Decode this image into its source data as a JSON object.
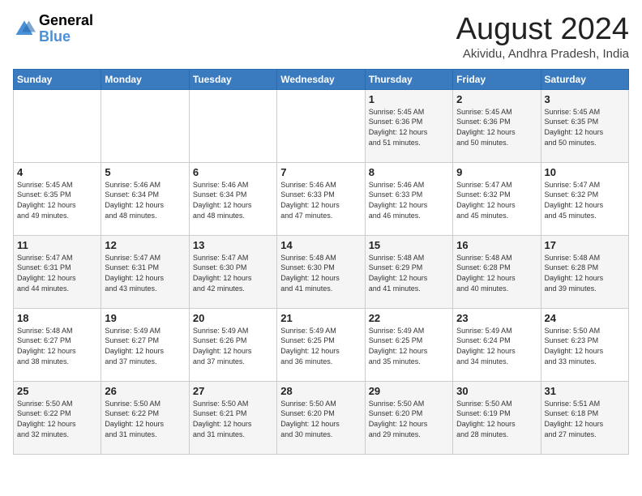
{
  "logo": {
    "text_general": "General",
    "text_blue": "Blue"
  },
  "title": "August 2024",
  "subtitle": "Akividu, Andhra Pradesh, India",
  "days_of_week": [
    "Sunday",
    "Monday",
    "Tuesday",
    "Wednesday",
    "Thursday",
    "Friday",
    "Saturday"
  ],
  "weeks": [
    [
      {
        "day": "",
        "info": ""
      },
      {
        "day": "",
        "info": ""
      },
      {
        "day": "",
        "info": ""
      },
      {
        "day": "",
        "info": ""
      },
      {
        "day": "1",
        "info": "Sunrise: 5:45 AM\nSunset: 6:36 PM\nDaylight: 12 hours\nand 51 minutes."
      },
      {
        "day": "2",
        "info": "Sunrise: 5:45 AM\nSunset: 6:36 PM\nDaylight: 12 hours\nand 50 minutes."
      },
      {
        "day": "3",
        "info": "Sunrise: 5:45 AM\nSunset: 6:35 PM\nDaylight: 12 hours\nand 50 minutes."
      }
    ],
    [
      {
        "day": "4",
        "info": "Sunrise: 5:45 AM\nSunset: 6:35 PM\nDaylight: 12 hours\nand 49 minutes."
      },
      {
        "day": "5",
        "info": "Sunrise: 5:46 AM\nSunset: 6:34 PM\nDaylight: 12 hours\nand 48 minutes."
      },
      {
        "day": "6",
        "info": "Sunrise: 5:46 AM\nSunset: 6:34 PM\nDaylight: 12 hours\nand 48 minutes."
      },
      {
        "day": "7",
        "info": "Sunrise: 5:46 AM\nSunset: 6:33 PM\nDaylight: 12 hours\nand 47 minutes."
      },
      {
        "day": "8",
        "info": "Sunrise: 5:46 AM\nSunset: 6:33 PM\nDaylight: 12 hours\nand 46 minutes."
      },
      {
        "day": "9",
        "info": "Sunrise: 5:47 AM\nSunset: 6:32 PM\nDaylight: 12 hours\nand 45 minutes."
      },
      {
        "day": "10",
        "info": "Sunrise: 5:47 AM\nSunset: 6:32 PM\nDaylight: 12 hours\nand 45 minutes."
      }
    ],
    [
      {
        "day": "11",
        "info": "Sunrise: 5:47 AM\nSunset: 6:31 PM\nDaylight: 12 hours\nand 44 minutes."
      },
      {
        "day": "12",
        "info": "Sunrise: 5:47 AM\nSunset: 6:31 PM\nDaylight: 12 hours\nand 43 minutes."
      },
      {
        "day": "13",
        "info": "Sunrise: 5:47 AM\nSunset: 6:30 PM\nDaylight: 12 hours\nand 42 minutes."
      },
      {
        "day": "14",
        "info": "Sunrise: 5:48 AM\nSunset: 6:30 PM\nDaylight: 12 hours\nand 41 minutes."
      },
      {
        "day": "15",
        "info": "Sunrise: 5:48 AM\nSunset: 6:29 PM\nDaylight: 12 hours\nand 41 minutes."
      },
      {
        "day": "16",
        "info": "Sunrise: 5:48 AM\nSunset: 6:28 PM\nDaylight: 12 hours\nand 40 minutes."
      },
      {
        "day": "17",
        "info": "Sunrise: 5:48 AM\nSunset: 6:28 PM\nDaylight: 12 hours\nand 39 minutes."
      }
    ],
    [
      {
        "day": "18",
        "info": "Sunrise: 5:48 AM\nSunset: 6:27 PM\nDaylight: 12 hours\nand 38 minutes."
      },
      {
        "day": "19",
        "info": "Sunrise: 5:49 AM\nSunset: 6:27 PM\nDaylight: 12 hours\nand 37 minutes."
      },
      {
        "day": "20",
        "info": "Sunrise: 5:49 AM\nSunset: 6:26 PM\nDaylight: 12 hours\nand 37 minutes."
      },
      {
        "day": "21",
        "info": "Sunrise: 5:49 AM\nSunset: 6:25 PM\nDaylight: 12 hours\nand 36 minutes."
      },
      {
        "day": "22",
        "info": "Sunrise: 5:49 AM\nSunset: 6:25 PM\nDaylight: 12 hours\nand 35 minutes."
      },
      {
        "day": "23",
        "info": "Sunrise: 5:49 AM\nSunset: 6:24 PM\nDaylight: 12 hours\nand 34 minutes."
      },
      {
        "day": "24",
        "info": "Sunrise: 5:50 AM\nSunset: 6:23 PM\nDaylight: 12 hours\nand 33 minutes."
      }
    ],
    [
      {
        "day": "25",
        "info": "Sunrise: 5:50 AM\nSunset: 6:22 PM\nDaylight: 12 hours\nand 32 minutes."
      },
      {
        "day": "26",
        "info": "Sunrise: 5:50 AM\nSunset: 6:22 PM\nDaylight: 12 hours\nand 31 minutes."
      },
      {
        "day": "27",
        "info": "Sunrise: 5:50 AM\nSunset: 6:21 PM\nDaylight: 12 hours\nand 31 minutes."
      },
      {
        "day": "28",
        "info": "Sunrise: 5:50 AM\nSunset: 6:20 PM\nDaylight: 12 hours\nand 30 minutes."
      },
      {
        "day": "29",
        "info": "Sunrise: 5:50 AM\nSunset: 6:20 PM\nDaylight: 12 hours\nand 29 minutes."
      },
      {
        "day": "30",
        "info": "Sunrise: 5:50 AM\nSunset: 6:19 PM\nDaylight: 12 hours\nand 28 minutes."
      },
      {
        "day": "31",
        "info": "Sunrise: 5:51 AM\nSunset: 6:18 PM\nDaylight: 12 hours\nand 27 minutes."
      }
    ]
  ]
}
